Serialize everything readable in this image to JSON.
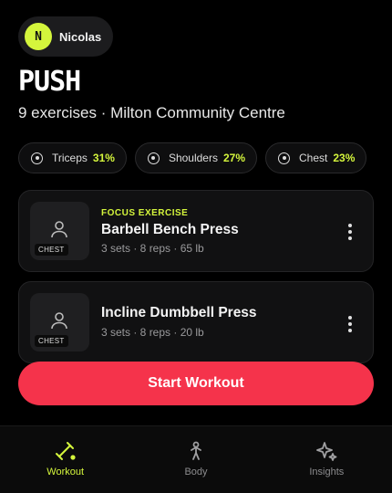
{
  "user": {
    "initial": "N",
    "name": "Nicolas"
  },
  "workout": {
    "title": "PUSH",
    "subtitle": "9 exercises · Milton Community Centre"
  },
  "muscles": [
    {
      "label": "Triceps",
      "pct": "31%"
    },
    {
      "label": "Shoulders",
      "pct": "27%"
    },
    {
      "label": "Chest",
      "pct": "23%"
    }
  ],
  "exercises": [
    {
      "focus": "FOCUS EXERCISE",
      "name": "Barbell Bench Press",
      "meta": "3 sets · 8 reps · 65 lb",
      "tag": "CHEST"
    },
    {
      "name": "Incline Dumbbell Press",
      "meta": "3 sets · 8 reps · 20 lb",
      "tag": "CHEST"
    }
  ],
  "start_button": "Start Workout",
  "tabs": [
    {
      "label": "Workout",
      "icon": "dumbbell-icon",
      "active": true
    },
    {
      "label": "Body",
      "icon": "body-icon",
      "active": false
    },
    {
      "label": "Insights",
      "icon": "sparkle-icon",
      "active": false
    }
  ],
  "colors": {
    "accent": "#d4f53c",
    "primary_button": "#f5334b",
    "background": "#000000"
  }
}
